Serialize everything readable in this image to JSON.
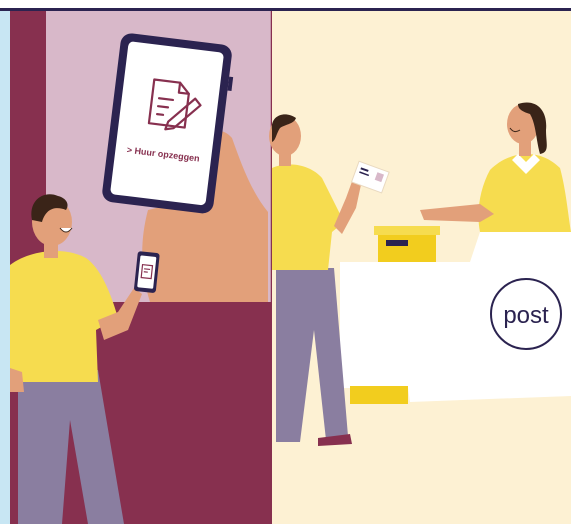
{
  "illustration": {
    "left_panel": {
      "phone_screen_label": "> Huur opzeggen"
    },
    "right_panel": {
      "counter_logo_text": "post"
    }
  },
  "colors": {
    "top_border": "#2b2350",
    "left_strip": "#c8e6f3",
    "maroon": "#87304f",
    "lilac_wall": "#d8b8c9",
    "cream_bg": "#fdf1d3",
    "counter_white": "#ffffff",
    "shirt_yellow": "#f6dc4f",
    "trousers_grey": "#8a7ea0",
    "skin": "#e2a07a",
    "navy": "#2b2350"
  }
}
